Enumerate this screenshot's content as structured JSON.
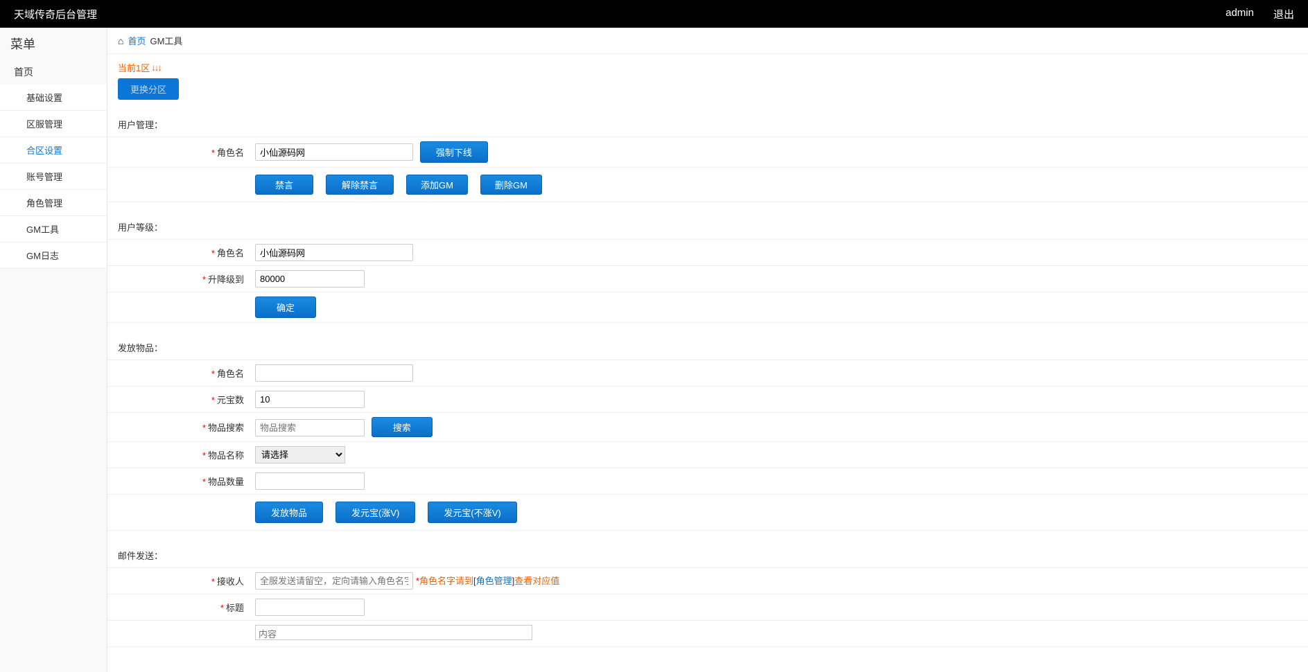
{
  "topbar": {
    "title": "天域传奇后台管理",
    "user": "admin",
    "logout": "退出"
  },
  "sidebar": {
    "menu_title": "菜单",
    "root": "首页",
    "items": [
      {
        "label": "基础设置",
        "active": false
      },
      {
        "label": "区服管理",
        "active": false
      },
      {
        "label": "合区设置",
        "active": true
      },
      {
        "label": "账号管理",
        "active": false
      },
      {
        "label": "角色管理",
        "active": false
      },
      {
        "label": "GM工具",
        "active": false
      },
      {
        "label": "GM日志",
        "active": false
      }
    ]
  },
  "breadcrumb": {
    "home": "首页",
    "current": "GM工具"
  },
  "zone": {
    "current": "当前1区",
    "change_btn": "更换分区"
  },
  "user_mgmt": {
    "title": "用户管理：",
    "role_label": "角色名",
    "role_value": "小仙源码网",
    "force_offline": "强制下线",
    "ban": "禁言",
    "unban": "解除禁言",
    "add_gm": "添加GM",
    "del_gm": "删除GM"
  },
  "user_level": {
    "title": "用户等级：",
    "role_label": "角色名",
    "role_value": "小仙源码网",
    "level_label": "升降级到",
    "level_value": "80000",
    "confirm": "确定"
  },
  "give_item": {
    "title": "发放物品：",
    "role_label": "角色名",
    "role_value": "",
    "gold_label": "元宝数",
    "gold_value": "10",
    "search_label": "物品搜索",
    "search_placeholder": "物品搜索",
    "search_btn": "搜索",
    "item_name_label": "物品名称",
    "item_name_option": "请选择",
    "item_qty_label": "物品数量",
    "item_qty_value": "",
    "give_btn": "发放物品",
    "gold_inc_btn": "发元宝(涨V)",
    "gold_noinc_btn": "发元宝(不涨V)"
  },
  "mail": {
    "title": "邮件发送：",
    "recipient_label": "接收人",
    "recipient_placeholder": "全服发送请留空，定向请输入角色名字",
    "hint_prefix": "角色名字请到",
    "hint_link": "角色管理",
    "hint_suffix": "查看对应值",
    "subject_label": "标题",
    "subject_value": "",
    "content_placeholder": "内容"
  }
}
